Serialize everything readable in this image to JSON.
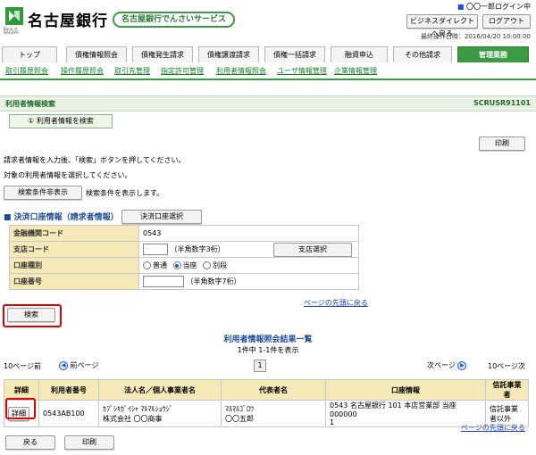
{
  "header": {
    "bank_name": "名古屋銀行",
    "service_name": "名古屋銀行でんさいサービス",
    "logo_sub": "Bank of NAGOYA",
    "login_user": "〇〇一郎ログイン中",
    "direct_btn": "ビジネスダイレクトへ戻る",
    "logout_btn": "ログアウト",
    "last_op": "最終操作日時：2016/04/20 10:00:00"
  },
  "tabs": [
    "トップ",
    "債権情報照会",
    "債権発生請求",
    "債権譲渡請求",
    "債権一括請求",
    "融資申込",
    "その他請求",
    "管理業務"
  ],
  "subnav": [
    "取引履歴照会",
    "操作履歴照会",
    "取引先管理",
    "指定許可管理",
    "利用者情報照会",
    "ユーザ情報管理",
    "企業情報管理"
  ],
  "page": {
    "title": "利用者情報検索",
    "screen_id": "SCRUSR91101",
    "step": "① 利用者情報を検索",
    "print": "印刷",
    "desc1": "請求者情報を入力後、「検索」ボタンを押してください。",
    "desc2": "対象の利用者情報を選択してください。",
    "toggle_btn": "検索条件非表示",
    "toggle_desc": "検索条件を表示します。"
  },
  "account": {
    "heading": "決済口座情報（請求者情報）",
    "select_btn": "決済口座選択",
    "rows": {
      "bank_code_label": "金融機関コード",
      "bank_code_value": "0543",
      "branch_label": "支店コード",
      "branch_hint": "（半角数字3桁）",
      "branch_btn": "支店選択",
      "type_label": "口座種別",
      "type_opt1": "普通",
      "type_opt2": "当座",
      "type_opt3": "別段",
      "number_label": "口座番号",
      "number_hint": "（半角数字7桁）"
    },
    "top_link": "ページの先頭に戻る"
  },
  "search_btn": "検索",
  "results": {
    "title": "利用者情報照会結果一覧",
    "count": "1件中 1-1件を表示",
    "prev10": "10ページ前",
    "prev": "前ページ",
    "page": "1",
    "next": "次ページ",
    "next10": "10ページ次",
    "headers": [
      "詳細",
      "利用者番号",
      "法人名／個人事業者名",
      "代表者名",
      "口座情報",
      "信託事業者"
    ],
    "row": {
      "detail": "詳細",
      "user_no": "0543AB100",
      "corp_kana": "ｶﾌﾞｼｷｶﾞｲｼｬ ﾏﾙﾏﾙｼｮｳｼﾞ",
      "corp_name": "株式会社 〇〇商事",
      "rep_kana": "ﾏﾙﾏﾙｺﾞﾛｳ",
      "rep_name": "〇〇五郎",
      "account_line1": "0543 名古屋銀行 101 本店営業部 当座 000000",
      "account_line2": "1",
      "trust": "信託事業者以外"
    },
    "top_link": "ページの先頭に戻る"
  },
  "footer": {
    "back": "戻る",
    "print": "印刷"
  },
  "colors": {
    "accent": "#3c9a44",
    "label_bg": "#f6e9b8",
    "highlight": "#e00000"
  }
}
